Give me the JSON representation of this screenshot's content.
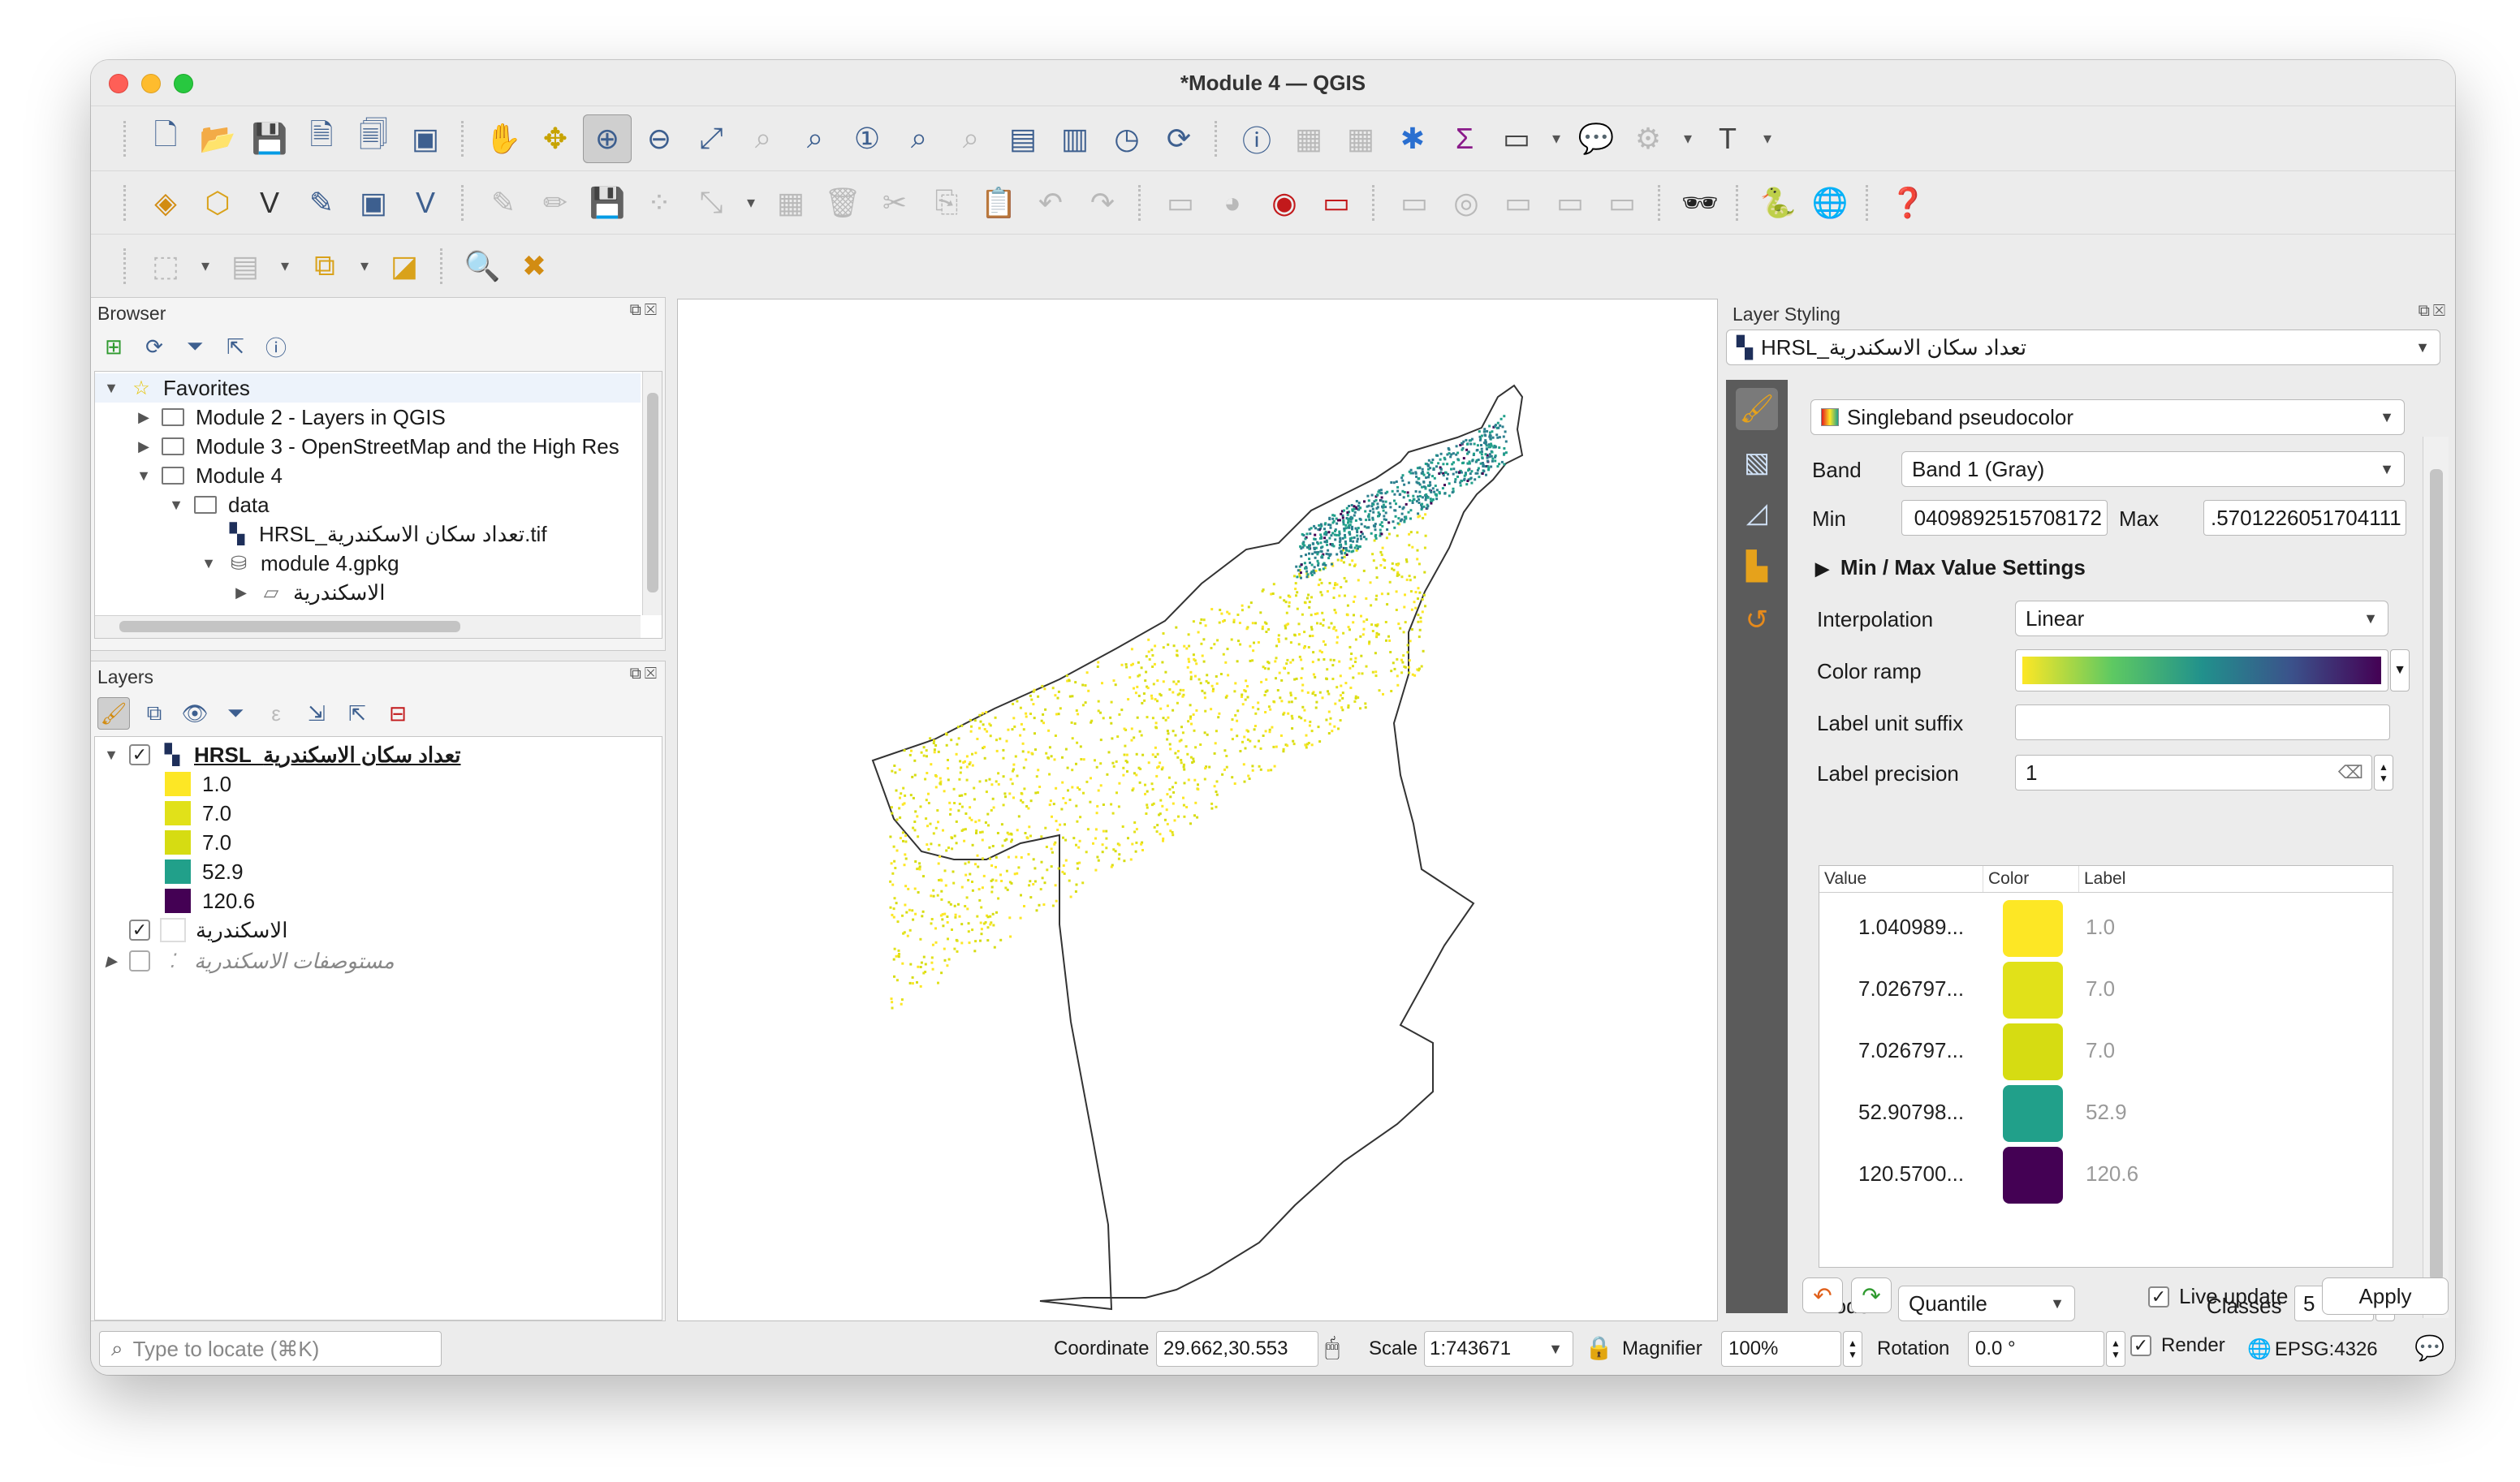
{
  "window": {
    "title": "*Module 4 — QGIS"
  },
  "browser": {
    "title": "Browser",
    "items": [
      {
        "label": "Favorites"
      },
      {
        "label": "Module 2 - Layers in QGIS"
      },
      {
        "label": "Module 3 - OpenStreetMap and the High Res"
      },
      {
        "label": "Module 4"
      },
      {
        "label": "data"
      },
      {
        "label": "HRSL_تعداد سكان الاسكندرية.tif"
      },
      {
        "label": "module 4.gpkg"
      },
      {
        "label": "الاسكندرية"
      }
    ]
  },
  "layers": {
    "title": "Layers",
    "raster_layer": "HRSL_تعداد سكان الاسكندرية",
    "legend": [
      {
        "label": "1.0",
        "color": "#fde725"
      },
      {
        "label": "7.0",
        "color": "#e1e119"
      },
      {
        "label": "7.0",
        "color": "#d6dc12"
      },
      {
        "label": "52.9",
        "color": "#21a08a"
      },
      {
        "label": "120.6",
        "color": "#440154"
      }
    ],
    "vector_layer": "الاسكندرية",
    "hidden_layer": "مستوصفات الاسكندرية"
  },
  "styling": {
    "title": "Layer Styling",
    "layer_combo": "HRSL_تعداد سكان الاسكندرية",
    "renderer": "Singleband pseudocolor",
    "band_label": "Band",
    "band_value": "Band 1 (Gray)",
    "min_label": "Min",
    "min_value": "040989251570817​2",
    "max_label": "Max",
    "max_value": ".5701226051704111",
    "minmax_settings": "Min / Max Value Settings",
    "interpolation_label": "Interpolation",
    "interpolation_value": "Linear",
    "color_ramp_label": "Color ramp",
    "label_suffix_label": "Label unit suffix",
    "label_precision_label": "Label precision",
    "label_precision_value": "1",
    "table_headers": {
      "value": "Value",
      "color": "Color",
      "label": "Label"
    },
    "classes": [
      {
        "value": "1.040989...",
        "color": "#fde725",
        "label": "1.0"
      },
      {
        "value": "7.026797...",
        "color": "#e1e119",
        "label": "7.0"
      },
      {
        "value": "7.026797...",
        "color": "#d6dc12",
        "label": "7.0"
      },
      {
        "value": "52.90798...",
        "color": "#21a08a",
        "label": "52.9"
      },
      {
        "value": "120.5700...",
        "color": "#440154",
        "label": "120.6"
      }
    ],
    "mode_label": "Mode",
    "mode_value": "Quantile",
    "classes_label": "Classes",
    "classes_value": "5",
    "live_update": "Live update",
    "apply": "Apply"
  },
  "status": {
    "locate_placeholder": "Type to locate (⌘K)",
    "coordinate_label": "Coordinate",
    "coordinate_value": "29.662,30.553",
    "scale_label": "Scale",
    "scale_value": "1:743671",
    "magnifier_label": "Magnifier",
    "magnifier_value": "100%",
    "rotation_label": "Rotation",
    "rotation_value": "0.0 °",
    "render_label": "Render",
    "crs": "EPSG:4326"
  }
}
